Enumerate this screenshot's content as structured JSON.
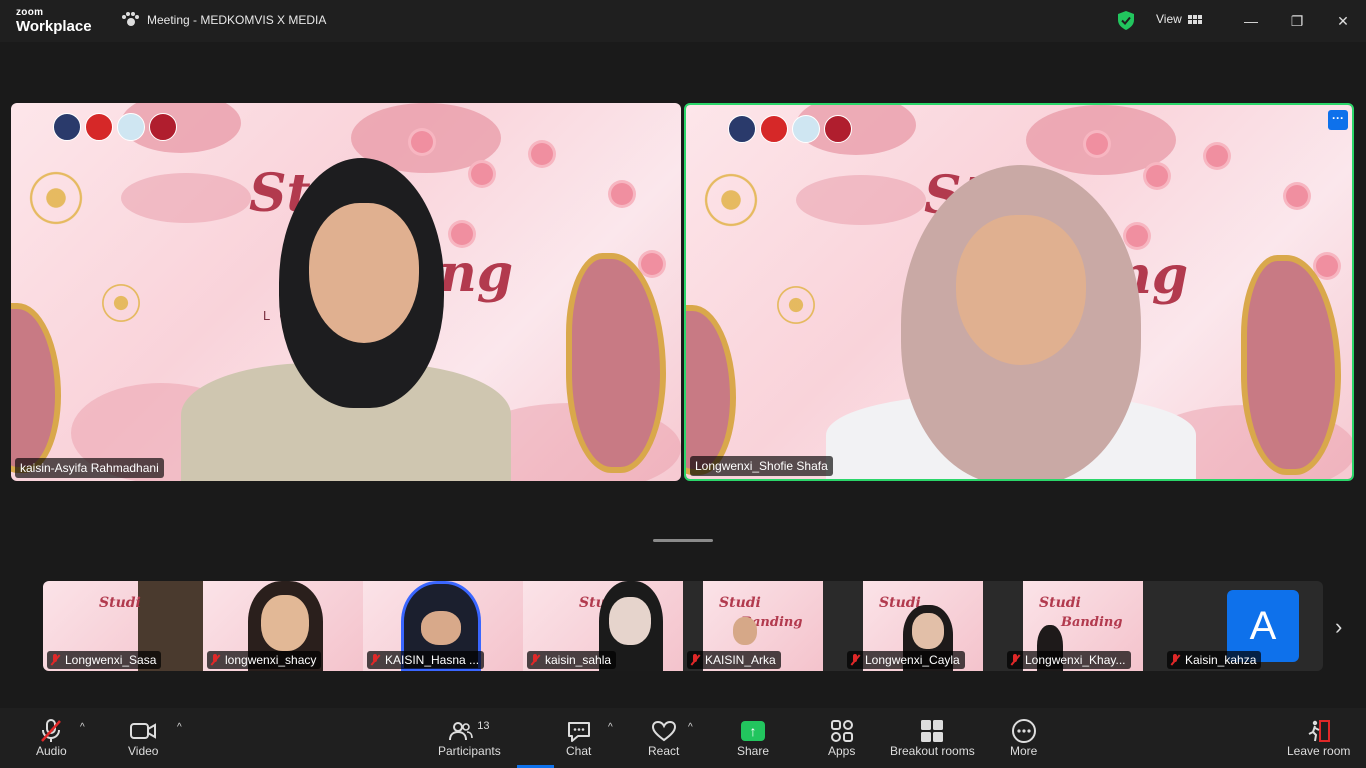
{
  "app": {
    "brand_top": "zoom",
    "brand_bottom": "Workplace",
    "meeting_title": "Meeting - MEDKOMVIS X MEDIA",
    "view_label": "View"
  },
  "window_controls": {
    "minimize": "—",
    "restore": "❐",
    "close": "✕"
  },
  "main_tiles": [
    {
      "name": "kaisin-Asyifa Rahmadhani",
      "background_text": "St",
      "background_text2": "ng",
      "background_text3": "L  O"
    },
    {
      "name": "Longwenxi_Shofie Shafa",
      "background_text": "St",
      "background_text2": "ng",
      "more": "···"
    }
  ],
  "thumbnails": [
    {
      "name": "Longwenxi_Sasa",
      "muted": true
    },
    {
      "name": "longwenxi_shacy",
      "muted": true
    },
    {
      "name": "KAISIN_Hasna ...",
      "muted": true
    },
    {
      "name": "kaisin_sahla",
      "muted": true
    },
    {
      "name": "KAISIN_Arka",
      "muted": true
    },
    {
      "name": "Longwenxi_Cayla",
      "muted": true
    },
    {
      "name": "Longwenxi_Khay...",
      "muted": true
    },
    {
      "name": "Kaisin_kahza",
      "muted": true,
      "avatar_letter": "A"
    }
  ],
  "thumb_bg_text": {
    "studi": "Studi",
    "banding": "Banding"
  },
  "strip_next": "›",
  "toolbar": {
    "audio": "Audio",
    "video": "Video",
    "participants": "Participants",
    "participants_count": "13",
    "chat": "Chat",
    "react": "React",
    "share": "Share",
    "apps": "Apps",
    "breakout": "Breakout rooms",
    "more": "More",
    "leave": "Leave room",
    "caret": "^"
  },
  "colors": {
    "active_speaker": "#2bd66a",
    "accent": "#0e71eb",
    "share": "#22c55e",
    "muted": "#e02828"
  },
  "icons": [
    "paw-icon",
    "shield-icon",
    "grid-icon",
    "mic-muted-icon",
    "camera-icon",
    "participants-icon",
    "chat-icon",
    "heart-icon",
    "share-up-icon",
    "apps-icon",
    "breakout-icon",
    "more-icon",
    "leave-icon"
  ]
}
